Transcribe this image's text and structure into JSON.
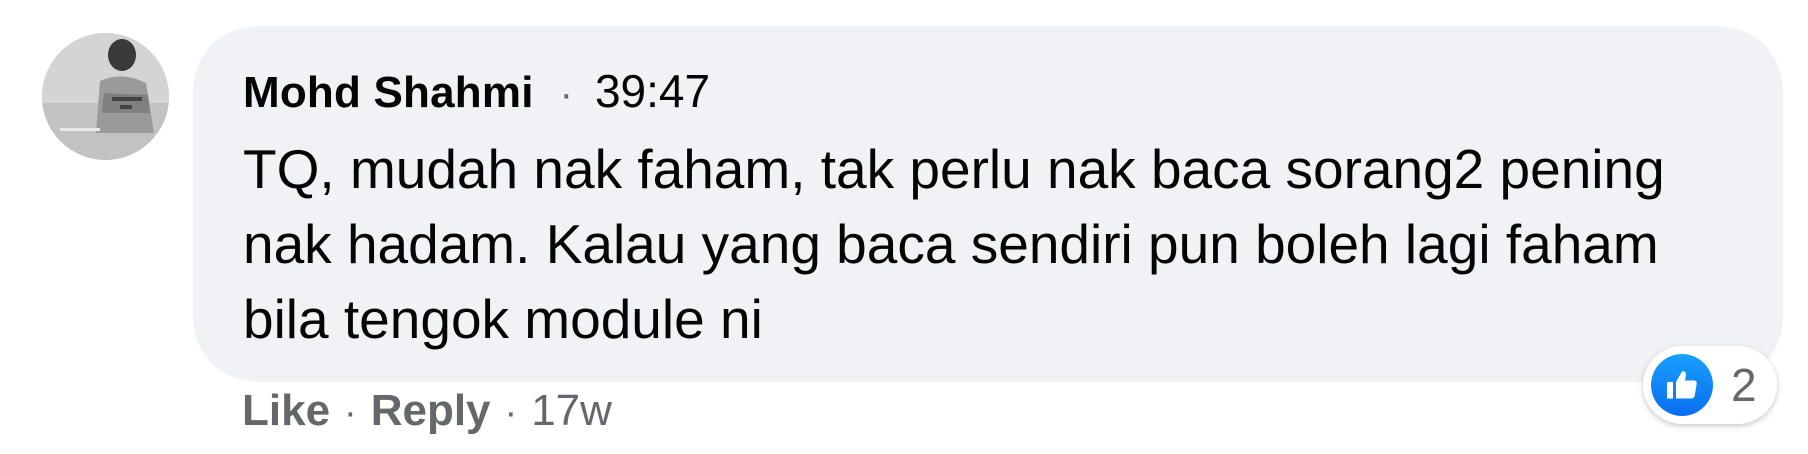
{
  "comment": {
    "author": "Mohd Shahmi",
    "separator": "·",
    "timestamp": "39:47",
    "text": "TQ, mudah nak faham, tak perlu nak baca sorang2 pening nak hadam. Kalau yang baca sendiri pun boleh lagi faham bila tengok module ni",
    "avatar_icon": "user-avatar-photo"
  },
  "actions": {
    "like_label": "Like",
    "separator": "·",
    "reply_label": "Reply",
    "age": "17w"
  },
  "reactions": {
    "icon": "thumbs-up-icon",
    "count": "2",
    "color": "#1877f2"
  }
}
